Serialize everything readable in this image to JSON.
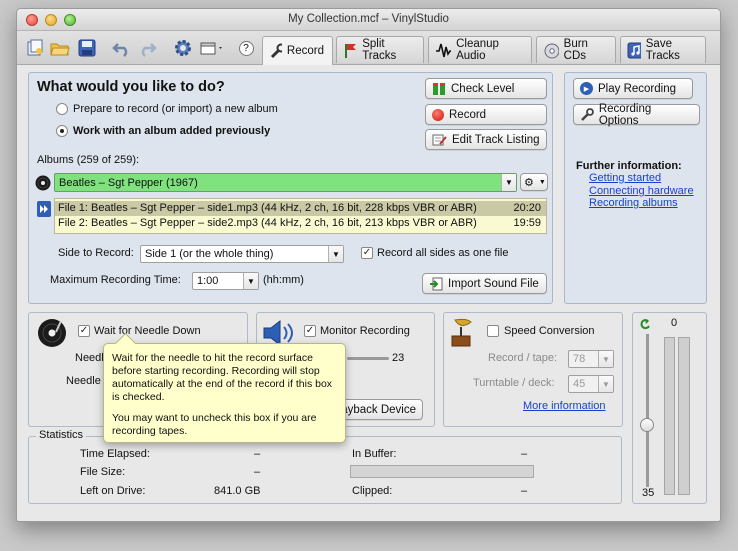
{
  "window": {
    "title": "My Collection.mcf – VinylStudio"
  },
  "toolbar": {
    "icons": [
      "new-collection-icon",
      "open-folder-icon",
      "save-disk-icon",
      "undo-icon",
      "redo-icon",
      "settings-gear-icon",
      "window-menu-icon",
      "help-icon"
    ],
    "help_label": "?",
    "tabs": [
      {
        "label": "Record",
        "icon": "wrench-icon",
        "active": true
      },
      {
        "label": "Split Tracks",
        "icon": "flag-icon",
        "active": false
      },
      {
        "label": "Cleanup Audio",
        "icon": "waveform-icon",
        "active": false
      },
      {
        "label": "Burn CDs",
        "icon": "disc-icon",
        "active": false
      },
      {
        "label": "Save Tracks",
        "icon": "save-tracks-icon",
        "active": false
      }
    ]
  },
  "main": {
    "heading": "What would you like to do?",
    "option_new": "Prepare to record (or import) a new album",
    "option_existing": "Work with an album added previously",
    "albums_label": "Albums (259 of 259):",
    "album_selected": "Beatles – Sgt Pepper (1967)",
    "files": [
      {
        "name": "File 1: Beatles – Sgt Pepper – side1.mp3 (44 kHz, 2 ch, 16 bit, 228 kbps VBR or ABR)",
        "duration": "20:20"
      },
      {
        "name": "File 2: Beatles – Sgt Pepper – side2.mp3 (44 kHz, 2 ch, 16 bit, 213 kbps VBR or ABR)",
        "duration": "19:59"
      }
    ],
    "side_label": "Side to Record:",
    "side_value": "Side 1 (or the whole thing)",
    "record_all_sides": "Record all sides as one file",
    "max_time_label": "Maximum Recording Time:",
    "max_time_value": "1:00",
    "max_time_unit": "(hh:mm)",
    "buttons": {
      "check_level": "Check Level",
      "record": "Record",
      "edit_track_listing": "Edit Track Listing",
      "import_sound_file": "Import Sound File"
    }
  },
  "side_panel": {
    "play_recording": "Play Recording",
    "recording_options": "Recording Options",
    "further_info": "Further information:",
    "links": [
      "Getting started",
      "Connecting hardware",
      "Recording albums"
    ]
  },
  "needle": {
    "wait_label": "Wait for Needle Down",
    "label1": "Needle",
    "label2": "Needle"
  },
  "monitor": {
    "monitor_label": "Monitor Recording",
    "volume_value": "23",
    "playback_button": "Playback Device"
  },
  "speed": {
    "label": "Speed Conversion",
    "record_tape_label": "Record / tape:",
    "record_tape_value": "78",
    "turntable_label": "Turntable / deck:",
    "turntable_value": "45",
    "more_info": "More information"
  },
  "level": {
    "top_value": "0",
    "bottom_value": "35"
  },
  "stats": {
    "title": "Statistics",
    "time_elapsed_label": "Time Elapsed:",
    "time_elapsed_value": "–",
    "file_size_label": "File Size:",
    "file_size_value": "–",
    "left_on_drive_label": "Left on Drive:",
    "left_on_drive_value": "841.0 GB",
    "in_buffer_label": "In Buffer:",
    "in_buffer_value": "–",
    "clipped_label": "Clipped:",
    "clipped_value": "–"
  },
  "tooltip": {
    "para1": "Wait for the needle to hit the record surface before starting recording. Recording will stop automatically at the end of the record if this box is checked.",
    "para2": "You may want to uncheck this box if you are recording tapes."
  },
  "colors": {
    "album_highlight": "#7fe27f",
    "file_row_selected": "#c9c9a6",
    "file_list_bg": "#fafad2",
    "link": "#1a3fd0",
    "tooltip_bg": "#ffffcc"
  }
}
